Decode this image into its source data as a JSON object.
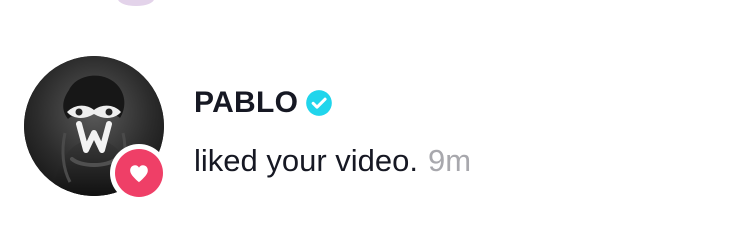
{
  "notification": {
    "username": "PABLO",
    "message": "liked your video.",
    "time": "9m",
    "avatar_icon": "user-avatar",
    "verified_icon": "verified-badge-icon",
    "like_icon": "heart-icon"
  },
  "colors": {
    "text_primary": "#161823",
    "text_secondary": "#a8a8ad",
    "verified_blue": "#20d5ec",
    "like_pink": "#ef3f67",
    "background": "#ffffff"
  }
}
